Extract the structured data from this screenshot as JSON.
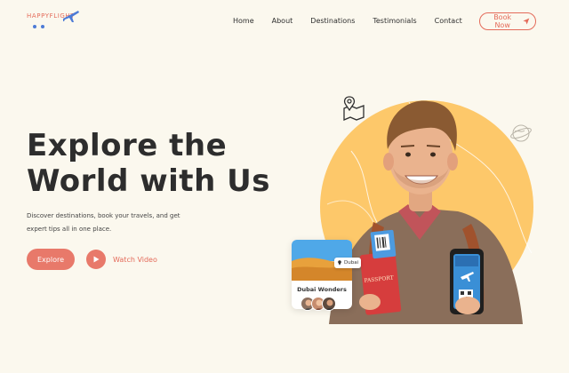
{
  "brand": {
    "name": "HAPPYFLIGHT",
    "accent": "#e8796a",
    "background": "#fbf8ee",
    "circle": "#fdc86a"
  },
  "nav": {
    "links": [
      "Home",
      "About",
      "Destinations",
      "Testimonials",
      "Contact"
    ],
    "cta": "Book Now",
    "cta_icon": "send-icon"
  },
  "hero": {
    "title_line1": "Explore the",
    "title_line2": "World with Us",
    "description": "Discover destinations, book your travels, and get expert tips all in one place.",
    "explore_label": "Explore",
    "watch_label": "Watch Video"
  },
  "card": {
    "title": "Dubai Wonders",
    "location": "Dubai"
  },
  "passport": {
    "label": "PASSPORT"
  },
  "icons": [
    "plane-icon",
    "send-icon",
    "play-icon",
    "map-pin-icon",
    "globe-icon",
    "location-icon"
  ]
}
